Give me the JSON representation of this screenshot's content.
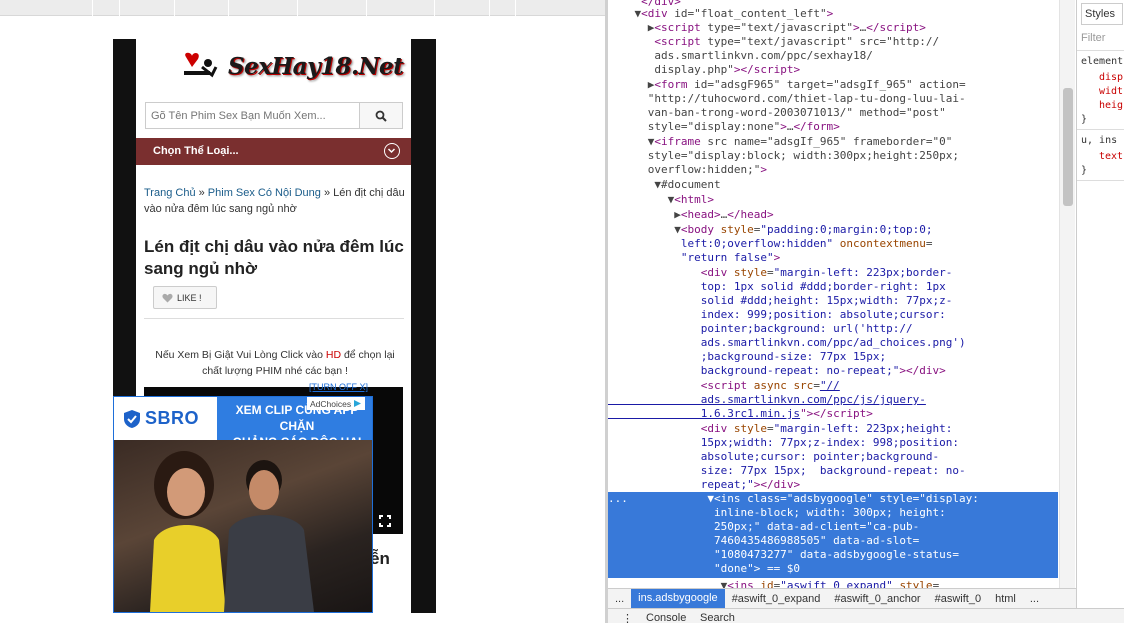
{
  "site": {
    "logo": "SexHay18.Net",
    "search_placeholder": "Gõ Tên Phim Sex Bạn Muốn Xem...",
    "category": "Chọn Thể Loại...",
    "breadcrumb": {
      "home": "Trang Chủ",
      "sep": " » ",
      "cat": "Phim Sex Có Nội Dung",
      "current": "Lén địt chị dâu vào nửa đêm lúc sang ngủ nhờ"
    },
    "title": "Lén địt chị dâu vào nửa đêm lúc sang ngủ nhờ",
    "like": "LIKE !",
    "notice_before": "Nếu Xem Bị Giật Vui Lòng Click vào ",
    "notice_hd": "HD",
    "notice_after": " để chọn lại chất lượng PHIM nhé các bạn !",
    "under_text": "ễn"
  },
  "ad": {
    "turn_off": "[TURN OFF X]",
    "adchoices": "AdChoices",
    "brand": "SBRO",
    "line1": "XEM CLIP CÙNG APP CHẶN",
    "line2": "QUẢNG CÁO ĐỘC HẠI"
  },
  "devtools": {
    "lines": [
      {
        "pre": "    ▼",
        "html": "&lt;div id=\"float_content_left\"&gt;"
      },
      {
        "pre": "      ▶",
        "html": "&lt;script type=\"text/javascript\"&gt;…&lt;/script&gt;"
      },
      {
        "pre": "       ",
        "html": "&lt;script type=\"text/javascript\" src=\"http://"
      },
      {
        "pre": "       ",
        "html": "ads.smartlinkvn.com/ppc/sexhay18/"
      },
      {
        "pre": "       ",
        "html": "display.php\"&gt;&lt;/script&gt;"
      },
      {
        "pre": "      ▶",
        "html": "&lt;form id=\"adsgF965\" target=\"adsgIf_965\" action="
      },
      {
        "pre": "      ",
        "html": "\"http://tuhocword.com/thiet-lap-tu-dong-luu-lai-"
      },
      {
        "pre": "      ",
        "html": "van-ban-trong-word-2003071013/\" method=\"post\""
      },
      {
        "pre": "      ",
        "html": "style=\"display:none\"&gt;…&lt;/form&gt;"
      },
      {
        "pre": "      ▼",
        "html": "&lt;iframe src name=\"adsgIf_965\" frameborder=\"0\""
      },
      {
        "pre": "      ",
        "html": "style=\"display:block; width:300px;height:250px;"
      },
      {
        "pre": "      ",
        "html": "overflow:hidden;\"&gt;"
      }
    ],
    "breadcrumbs": [
      "...",
      "ins.adsbygoogle",
      "#aswift_0_expand",
      "#aswift_0_anchor",
      "#aswift_0",
      "html",
      "..."
    ],
    "drawer_tabs": [
      "Console",
      "Search"
    ],
    "styles_tab": "Styles",
    "filter": "Filter",
    "styles_lines": [
      "element",
      "disp",
      "widt",
      "heig",
      "}",
      "u, ins",
      "text",
      "}"
    ]
  }
}
